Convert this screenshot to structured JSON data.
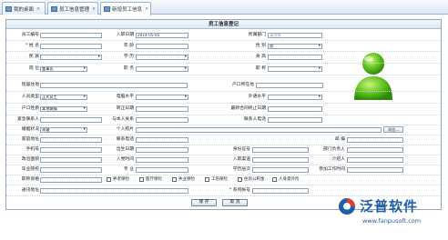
{
  "tabs": [
    {
      "label": "我的桌面",
      "close": "×"
    },
    {
      "label": "员工信息管理",
      "close": "×"
    },
    {
      "label": "新增员工信息",
      "close": "×"
    }
  ],
  "form_title": "员工信息登记",
  "fields": {
    "emp_no": "员工编号",
    "name": "姓    名",
    "ethnicity": "民    族",
    "position": "岗    位",
    "position_value": "董事长",
    "entry_date": "入职日期",
    "entry_date_value": "2014-05-05",
    "age": "年    龄",
    "education": "学    历",
    "duty": "职    务",
    "department": "所属部门",
    "department_placeholder": "请选择",
    "gender": "性    别",
    "gender_value": "男",
    "status": "身    高",
    "title": "职    称",
    "current_address": "现居住地",
    "hukou_address": "户口所在地",
    "staff_type": "人员类型",
    "staff_type_value": "正式员工",
    "computer_level": "电脑水平",
    "foreign_level": "外语水平",
    "hukou_type": "户口性质",
    "hukou_type_value": "本地城镇",
    "regular_date": "转正日期",
    "contract_end": "最新合同终止日期",
    "emergency_contact": "紧急联系人",
    "relation": "与本人关系",
    "contact_phone": "联系人电话",
    "marital": "婚姻状况",
    "marital_value": "未婚",
    "personal_photo": "个人照片",
    "browse": "浏览...",
    "birthplace": "家庭地址",
    "id_number": "联系电话",
    "zip": "邮    编",
    "mobile": "手机号",
    "birth_date": "出生日期",
    "id_card": "身份证号",
    "dept_head": "部门负责人",
    "politics": "政治面貌",
    "join_party": "入党时间",
    "entry_channel": "入职渠道",
    "introducer": "介绍人",
    "school": "毕业院校",
    "major": "专    业",
    "degree": "学历层次",
    "work_start": "参加工作时间",
    "qualifications": "职称资格",
    "email": "通讯地址",
    "system_account": "系统帐号"
  },
  "insurance": [
    {
      "label": "养老保险"
    },
    {
      "label": "医疗保险"
    },
    {
      "label": "失业保险"
    },
    {
      "label": "工伤保险"
    },
    {
      "label": "住房公积金"
    },
    {
      "label": "人身意外险"
    }
  ],
  "buttons": {
    "save": "保 存",
    "cancel": "取 消"
  },
  "logo": {
    "text": "泛普软件",
    "url": "www.fanpusoft.com"
  }
}
